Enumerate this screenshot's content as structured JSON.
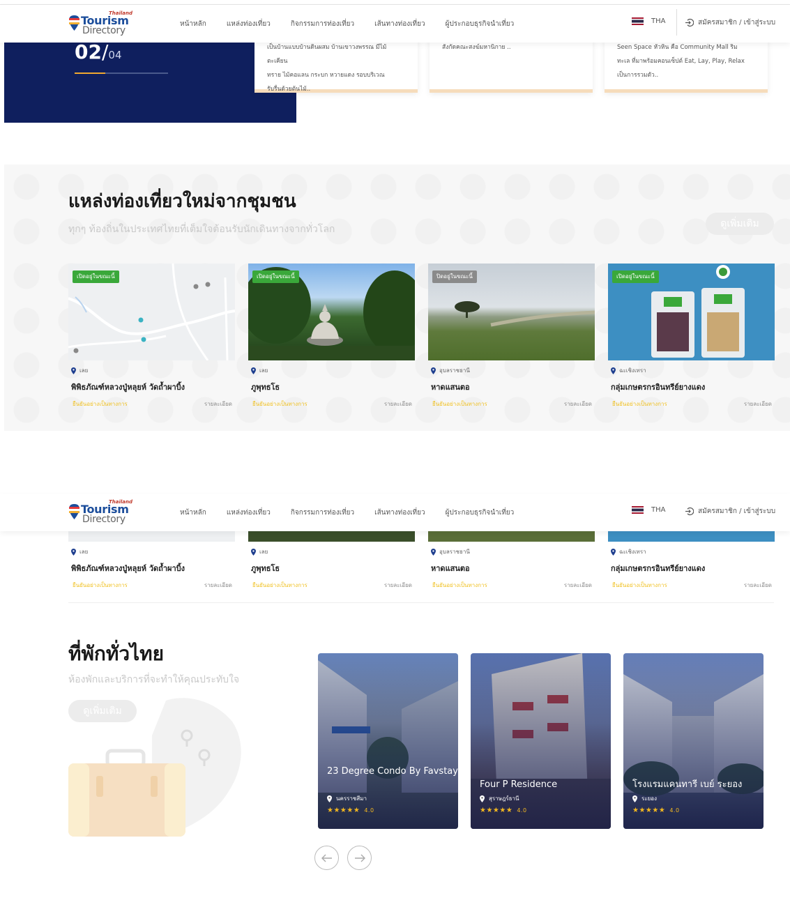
{
  "header": {
    "logo_small": "Thailand",
    "logo_line1": "Tourism",
    "logo_line2": "Directory",
    "nav": [
      "หน้าหลัก",
      "แหล่งท่องเที่ยว",
      "กิจกรรมการท่องเที่ยว",
      "เส้นทางท่องเที่ยว",
      "ผู้ประกอบธุรกิจนำเที่ยว"
    ],
    "lang": "THA",
    "login": "สมัครสมาชิก / เข้าสู่ระบบ"
  },
  "slider": {
    "current": "02",
    "slash": "/",
    "total": "04",
    "progress": 0.33,
    "cards": [
      {
        "lines": [
          "เป็นบ้านแบบบ้านดินผสม บ้านเขาวงพรรณ มีไม้ตะเคียน",
          "ทราย ไม้คอแลน กระบก หวายแดง รอบบริเวณ",
          "รับรื่นด้วยต้นไม้.."
        ]
      },
      {
        "lines": [
          "สังกัดคณะสงฆ์มหานิกาย .."
        ]
      },
      {
        "lines": [
          "Seen Space หัวหิน คือ Community Mall ริม",
          "ทะเล ที่มาพร้อมคอนเซ็ปต์ Eat, Lay, Play, Relax",
          "เป็นการรวมตัว.."
        ]
      }
    ]
  },
  "community": {
    "title": "แหล่งท่องเที่ยวใหม่จากชุมชน",
    "subtitle": "ทุกๆ ท้องถิ่นในประเทศไทยที่เต็มใจต้อนรับนักเดินทางจากทั่วโลก",
    "more": "ดูเพิ่มเติม",
    "cards": [
      {
        "badge": "เปิดอยู่ในขณะนี้",
        "open": true,
        "province": "เลย",
        "name": "พิพิธภัณฑ์หลวงปู่หลุยห์ วัดถ้ำผาบิ้ง",
        "status": "ยืนยันอย่างเป็นทางการ",
        "detail": "รายละเอียด"
      },
      {
        "badge": "เปิดอยู่ในขณะนี้",
        "open": true,
        "province": "เลย",
        "name": "ภูพุทธโธ",
        "status": "ยืนยันอย่างเป็นทางการ",
        "detail": "รายละเอียด"
      },
      {
        "badge": "ปิดอยู่ในขณะนี้",
        "open": false,
        "province": "อุบลราชธานี",
        "name": "หาดแสนตอ",
        "status": "ยืนยันอย่างเป็นทางการ",
        "detail": "รายละเอียด"
      },
      {
        "badge": "เปิดอยู่ในขณะนี้",
        "open": true,
        "province": "ฉะเชิงเทรา",
        "name": "กลุ่มเกษตรกรอินทรีย์ยางแดง",
        "status": "ยืนยันอย่างเป็นทางการ",
        "detail": "รายละเอียด"
      }
    ]
  },
  "stay": {
    "title": "ที่พักทั่วไทย",
    "subtitle": "ห้องพักและบริการที่จะทำให้คุณประทับใจ",
    "more": "ดูเพิ่มเติม",
    "hotels": [
      {
        "name": "23 Degree Condo By Favstay",
        "province": "นครราชสีมา",
        "stars": "★★★★★",
        "rating": "4.0"
      },
      {
        "name": "Four P Residence",
        "province": "สุราษฎร์ธานี",
        "stars": "★★★★★",
        "rating": "4.0"
      },
      {
        "name": "โรงแรมแคนทารี เบย์ ระยอง",
        "province": "ระยอง",
        "stars": "★★★★★",
        "rating": "4.0"
      }
    ]
  },
  "colors": {
    "navy": "#0f1f5e",
    "accent": "#f0a830",
    "open": "#3aa83a",
    "closed": "#8a8a8a",
    "verified": "#f0c020"
  }
}
